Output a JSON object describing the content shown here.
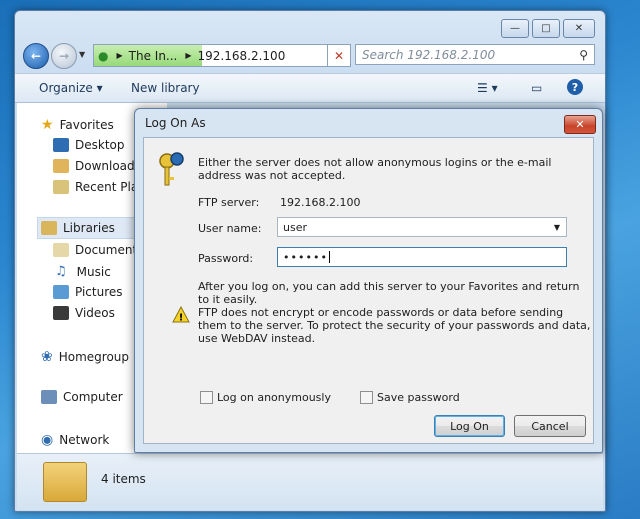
{
  "explorer": {
    "address": {
      "segment1": "The In...",
      "segment2": "192.168.2.100"
    },
    "search_placeholder": "Search 192.168.2.100",
    "toolbar": {
      "organize": "Organize",
      "new_library": "New library"
    },
    "nav": {
      "favorites": "Favorites",
      "desktop": "Desktop",
      "downloads": "Downloads",
      "recent_places": "Recent Plac",
      "libraries": "Libraries",
      "documents": "Documents",
      "music": "Music",
      "pictures": "Pictures",
      "videos": "Videos",
      "homegroup": "Homegroup",
      "computer": "Computer",
      "network": "Network"
    },
    "details": {
      "item_count": "4 items"
    }
  },
  "dialog": {
    "title": "Log On As",
    "message": "Either the server does not allow anonymous logins or the e-mail address was not accepted.",
    "ftp_server_label": "FTP server:",
    "ftp_server_value": "192.168.2.100",
    "username_label": "User name:",
    "username_value": "user",
    "password_label": "Password:",
    "password_value": "••••••",
    "info_text": "After you log on, you can add this server to your Favorites and return to it easily.",
    "warning_text": "FTP does not encrypt or encode passwords or data before sending them to the server.  To protect the security of your passwords and data, use WebDAV instead.",
    "anonymous_label": "Log on anonymously",
    "save_password_label": "Save password",
    "log_on_button": "Log On",
    "cancel_button": "Cancel"
  }
}
